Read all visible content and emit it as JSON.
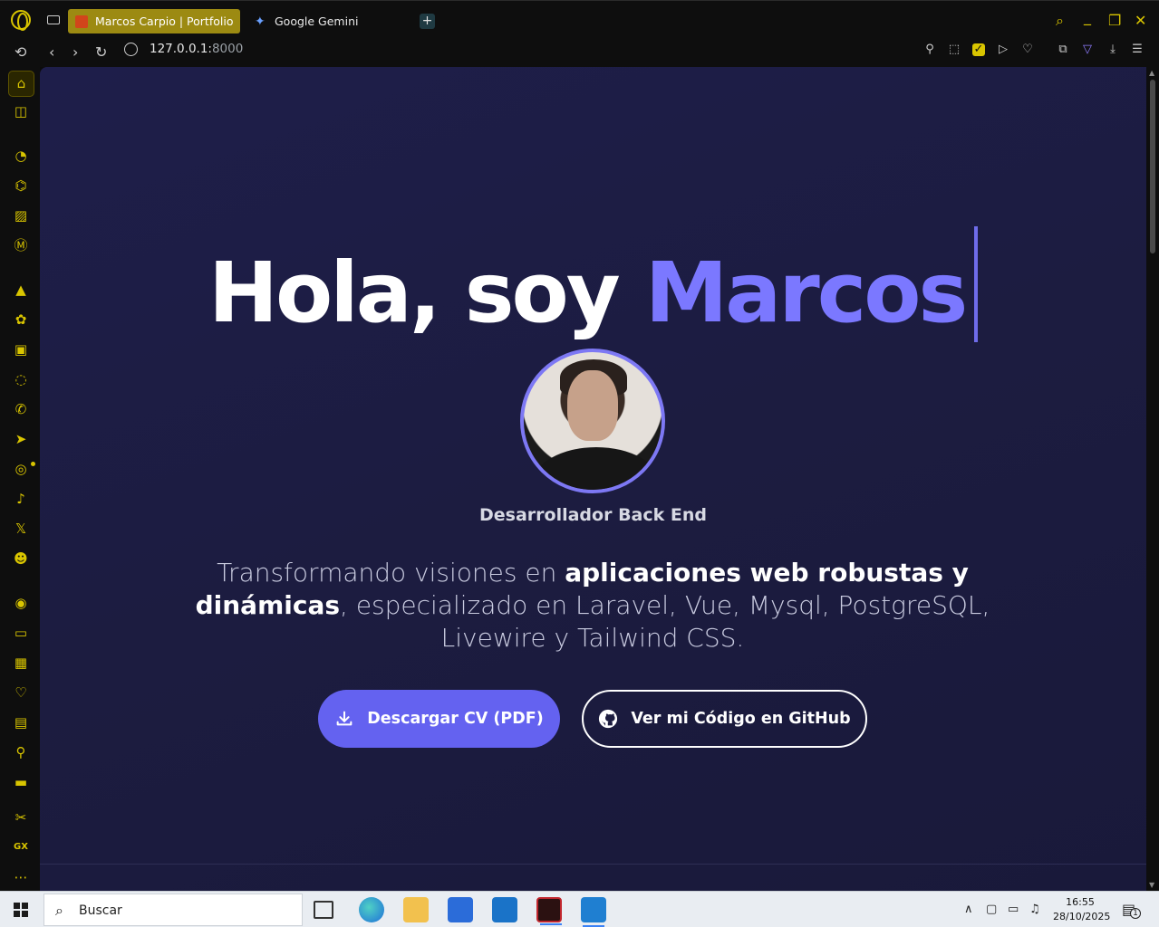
{
  "browser": {
    "tabs": [
      {
        "title": "Marcos Carpio | Portfolio",
        "active": true
      },
      {
        "title": "Google Gemini",
        "active": false
      }
    ],
    "new_tab": "+",
    "address": {
      "host": "127.0.0.1:",
      "port": "8000"
    }
  },
  "page": {
    "greeting": "Hola, soy",
    "name": "Marcos",
    "role": "Desarrollador Back End",
    "desc_1": "Transformando visiones en ",
    "desc_bold": "aplicaciones web robustas y dinámicas",
    "desc_2": ", especializado en Laravel, Vue, Mysql, PostgreSQL, Livewire y Tailwind CSS.",
    "btn_cv": "Descargar CV (PDF)",
    "btn_github": "Ver mi Código en GitHub"
  },
  "taskbar": {
    "search_placeholder": "Buscar",
    "time": "16:55",
    "date": "28/10/2025",
    "notification_count": "1"
  },
  "colors": {
    "accent": "#7b78ff",
    "button": "#6462f0",
    "opera_yellow": "#d9c500"
  }
}
